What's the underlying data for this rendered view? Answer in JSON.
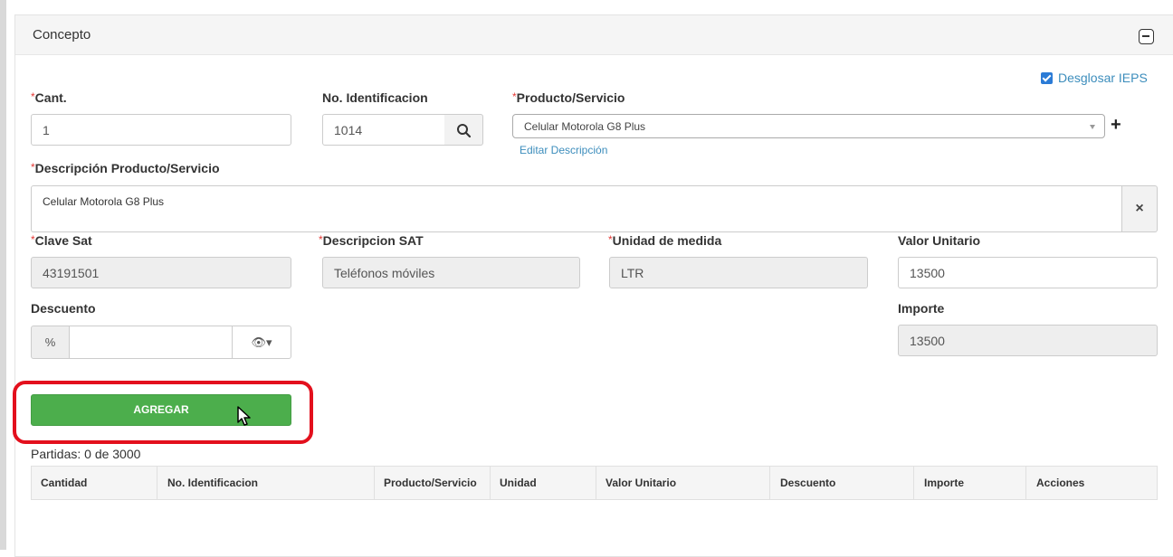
{
  "panel": {
    "title": "Concepto"
  },
  "ieps": {
    "label": "Desglosar IEPS",
    "checked": true
  },
  "fields": {
    "cant": {
      "label": "Cant.",
      "required": "*",
      "value": "1"
    },
    "no_identificacion": {
      "label": "No. Identificacion",
      "value": "1014"
    },
    "producto": {
      "label": "Producto/Servicio",
      "required": "*",
      "value": "Celular Motorola G8 Plus",
      "edit_link": "Editar Descripción",
      "add": "+"
    },
    "descripcion": {
      "label": "Descripción Producto/Servicio",
      "required": "*",
      "value": "Celular Motorola G8 Plus",
      "clear": "×"
    },
    "clave_sat": {
      "label": "Clave Sat",
      "required": "*",
      "value": "43191501"
    },
    "descripcion_sat": {
      "label": "Descripcion SAT",
      "required": "*",
      "value": "Teléfonos móviles"
    },
    "unidad": {
      "label": "Unidad de medida",
      "required": "*",
      "value": "LTR"
    },
    "valor_unitario": {
      "label": "Valor Unitario",
      "value": "13500"
    },
    "descuento": {
      "label": "Descuento",
      "addon": "%",
      "value": "",
      "eye": "👁▾"
    },
    "importe": {
      "label": "Importe",
      "value": "13500"
    }
  },
  "actions": {
    "agregar": "AGREGAR"
  },
  "partidas": "Partidas: 0 de 3000",
  "table": {
    "headers": [
      "Cantidad",
      "No. Identificacion",
      "Producto/Servicio",
      "Unidad",
      "Valor Unitario",
      "Descuento",
      "Importe",
      "Acciones"
    ]
  },
  "colors": {
    "accent_green": "#4cae4c",
    "highlight_red": "#e3101d",
    "link_blue": "#3c8dbc"
  }
}
